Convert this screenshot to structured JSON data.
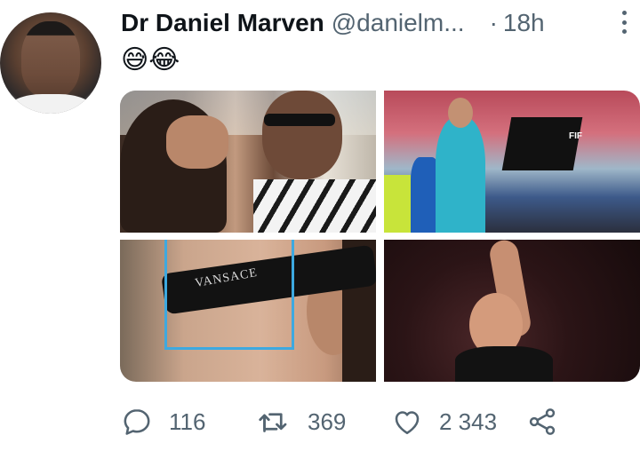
{
  "tweet": {
    "author_name": "Dr Daniel Marven",
    "handle": "@danielm...",
    "separator": "·",
    "time": "18h",
    "text": "😅😂"
  },
  "media": {
    "brand_text": "VANSACE",
    "stadium_sign": "FIF"
  },
  "actions": {
    "replies": "116",
    "retweets": "369",
    "likes": "2 343"
  },
  "colors": {
    "text_primary": "#0f1419",
    "text_secondary": "#536471",
    "highlight_box": "#3da9e0"
  },
  "icons": [
    "more-vertical-icon",
    "reply-icon",
    "retweet-icon",
    "like-icon",
    "share-icon"
  ]
}
